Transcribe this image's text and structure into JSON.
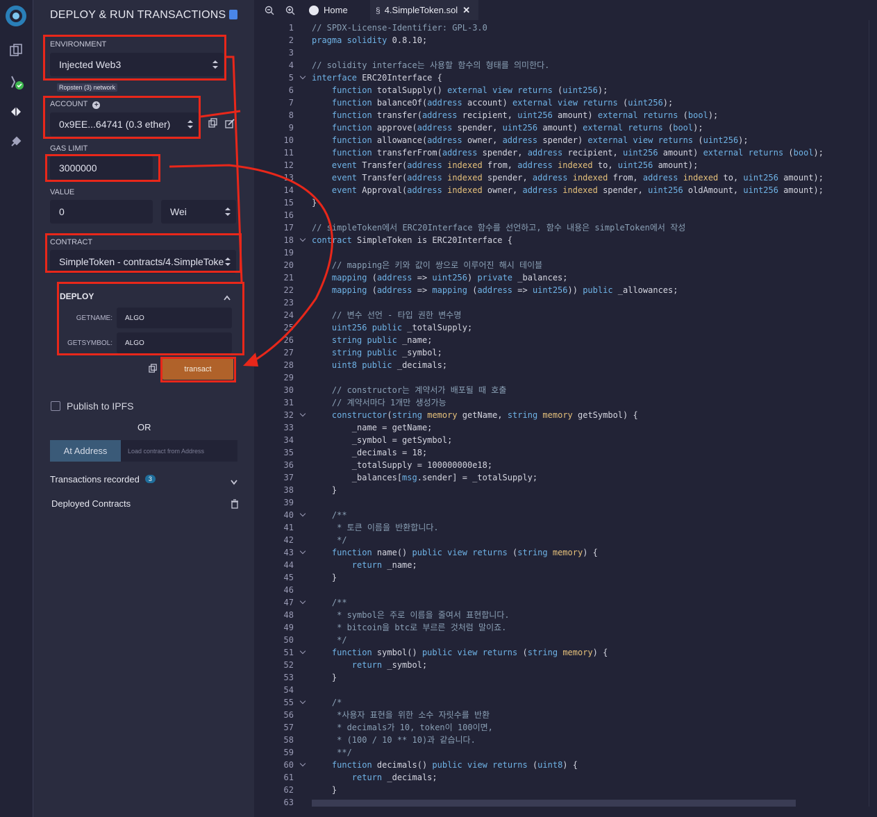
{
  "panel": {
    "title": "DEPLOY & RUN TRANSACTIONS",
    "environment": {
      "label": "ENVIRONMENT",
      "value": "Injected Web3",
      "network": "Ropsten (3) network"
    },
    "account": {
      "label": "ACCOUNT",
      "value": "0x9EE...64741 (0.3 ether)"
    },
    "gas_limit": {
      "label": "GAS LIMIT",
      "value": "3000000"
    },
    "value": {
      "label": "VALUE",
      "amount": "0",
      "unit": "Wei"
    },
    "contract": {
      "label": "CONTRACT",
      "value": "SimpleToken - contracts/4.SimpleToke"
    },
    "deploy": {
      "label": "DEPLOY",
      "params": [
        {
          "name": "GETNAME:",
          "value": "ALGO"
        },
        {
          "name": "GETSYMBOL:",
          "value": "ALGO"
        }
      ],
      "transact_label": "transact"
    },
    "publish_label": "Publish to IPFS",
    "or_label": "OR",
    "at_address_label": "At Address",
    "at_address_placeholder": "Load contract from Address",
    "transactions_label": "Transactions recorded",
    "transactions_count": "3",
    "deployed_label": "Deployed Contracts"
  },
  "tabs": [
    {
      "label": "Home"
    },
    {
      "label": "4.SimpleToken.sol"
    }
  ],
  "editor": {
    "lines": [
      "// SPDX-License-Identifier: GPL-3.0",
      "pragma solidity 0.8.10;",
      "",
      "// solidity interface는 사용할 함수의 형태를 의미한다.",
      "interface ERC20Interface {",
      "    function totalSupply() external view returns (uint256);",
      "    function balanceOf(address account) external view returns (uint256);",
      "    function transfer(address recipient, uint256 amount) external returns (bool);",
      "    function approve(address spender, uint256 amount) external returns (bool);",
      "    function allowance(address owner, address spender) external view returns (uint256);",
      "    function transferFrom(address spender, address recipient, uint256 amount) external returns (bool);",
      "    event Transfer(address indexed from, address indexed to, uint256 amount);",
      "    event Transfer(address indexed spender, address indexed from, address indexed to, uint256 amount);",
      "    event Approval(address indexed owner, address indexed spender, uint256 oldAmount, uint256 amount);",
      "}",
      "",
      "// simpleToken에서 ERC20Interface 함수를 선언하고, 함수 내용은 simpleToken에서 작성",
      "contract SimpleToken is ERC20Interface {",
      "",
      "    // mapping은 키와 값이 쌍으로 이루어진 해시 테이블",
      "    mapping (address => uint256) private _balances;",
      "    mapping (address => mapping (address => uint256)) public _allowances;",
      "",
      "    // 변수 선언 - 타입 권한 변수명",
      "    uint256 public _totalSupply;",
      "    string public _name;",
      "    string public _symbol;",
      "    uint8 public _decimals;",
      "",
      "    // constructor는 계약서가 배포될 때 호출",
      "    // 계약서마다 1개만 생성가능",
      "    constructor(string memory getName, string memory getSymbol) {",
      "        _name = getName;",
      "        _symbol = getSymbol;",
      "        _decimals = 18;",
      "        _totalSupply = 100000000e18;",
      "        _balances[msg.sender] = _totalSupply;",
      "    }",
      "",
      "    /**",
      "     * 토큰 이름을 반환합니다.",
      "     */",
      "    function name() public view returns (string memory) {",
      "        return _name;",
      "    }",
      "",
      "    /**",
      "     * symbol은 주로 이름을 줄여서 표현합니다.",
      "     * bitcoin을 btc로 부르른 것처럼 말이죠.",
      "     */",
      "    function symbol() public view returns (string memory) {",
      "        return _symbol;",
      "    }",
      "",
      "    /*",
      "     *사용자 표현을 위한 소수 자릿수를 반환",
      "     * decimals가 10, token이 100이면,",
      "     * (100 / 10 ** 10)과 같습니다.",
      "     **/",
      "    function decimals() public view returns (uint8) {",
      "        return _decimals;",
      "    }",
      ""
    ],
    "fold_lines": [
      5,
      18,
      32,
      40,
      43,
      47,
      51,
      55,
      60
    ]
  },
  "colors": {
    "annotation": "#e8271a",
    "transact": "#b0622a"
  }
}
